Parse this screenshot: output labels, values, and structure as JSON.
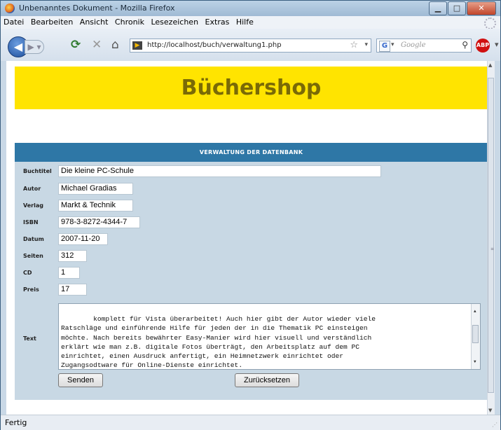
{
  "window": {
    "title": "Unbenanntes Dokument - Mozilla Firefox"
  },
  "menu": [
    "Datei",
    "Bearbeiten",
    "Ansicht",
    "Chronik",
    "Lesezeichen",
    "Extras",
    "Hilfe"
  ],
  "nav": {
    "url": "http://localhost/buch/verwaltung1.php",
    "search_placeholder": "Google",
    "abp_label": "ABP"
  },
  "page": {
    "header": "Büchershop",
    "panel_title": "VERWALTUNG DER DATENBANK",
    "fields": [
      {
        "label": "Buchtitel",
        "value": "Die kleine PC-Schule"
      },
      {
        "label": "Autor",
        "value": "Michael Gradias"
      },
      {
        "label": "Verlag",
        "value": "Markt & Technik"
      },
      {
        "label": "ISBN",
        "value": "978-3-8272-4344-7"
      },
      {
        "label": "Datum",
        "value": "2007-11-20"
      },
      {
        "label": "Seiten",
        "value": "312"
      },
      {
        "label": "CD",
        "value": "1"
      },
      {
        "label": "Preis",
        "value": "17"
      }
    ],
    "text_label": "Text",
    "text_value": "komplett für Vista überarbeitet! Auch hier gibt der Autor wieder viele\nRatschläge und einführende Hilfe für jeden der in die Thematik PC einsteigen\nmöchte. Nach bereits bewährter Easy-Manier wird hier visuell und verständlich\nerklärt wie man z.B. digitale Fotos überträgt, den Arbeitsplatz auf dem PC\neinrichtet, einen Ausdruck anfertigt, ein Heimnetzwerk einrichtet oder\nZugangsodtware für Online-Dienste einrichtet.",
    "submit_label": "Senden",
    "reset_label": "Zurücksetzen"
  },
  "status": {
    "text": "Fertig"
  }
}
